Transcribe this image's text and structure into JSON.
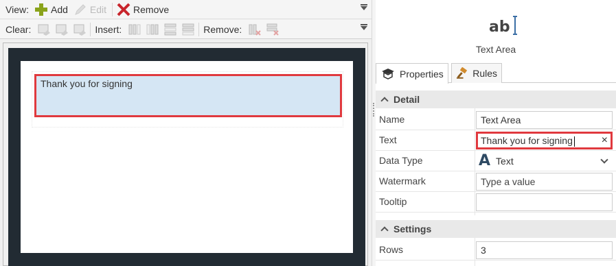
{
  "toolbar1": {
    "view_label": "View:",
    "add_label": "Add",
    "edit_label": "Edit",
    "remove_label": "Remove"
  },
  "toolbar2": {
    "clear_label": "Clear:",
    "insert_label": "Insert:",
    "remove_label": "Remove:"
  },
  "canvas": {
    "textarea_text": "Thank you for signing"
  },
  "panel": {
    "control_icon_text": "ab",
    "control_title": "Text Area",
    "tabs": [
      {
        "label": "Properties",
        "active": true
      },
      {
        "label": "Rules",
        "active": false
      }
    ],
    "sections": {
      "detail": "Detail",
      "settings": "Settings"
    },
    "properties": {
      "name": {
        "label": "Name",
        "value": "Text Area"
      },
      "text": {
        "label": "Text",
        "value": "Thank you for signing",
        "clear": "×"
      },
      "data_type": {
        "label": "Data Type",
        "value": "Text",
        "icon": "A"
      },
      "watermark": {
        "label": "Watermark",
        "placeholder": "Type a value"
      },
      "tooltip": {
        "label": "Tooltip",
        "value": ""
      },
      "rows": {
        "label": "Rows",
        "value": "3"
      }
    }
  },
  "colors": {
    "highlight": "#e0393e",
    "canvas_dark": "#222b33",
    "textarea_bg": "#d5e6f4",
    "add_green": "#8aa31b",
    "remove_red": "#c8252c"
  }
}
